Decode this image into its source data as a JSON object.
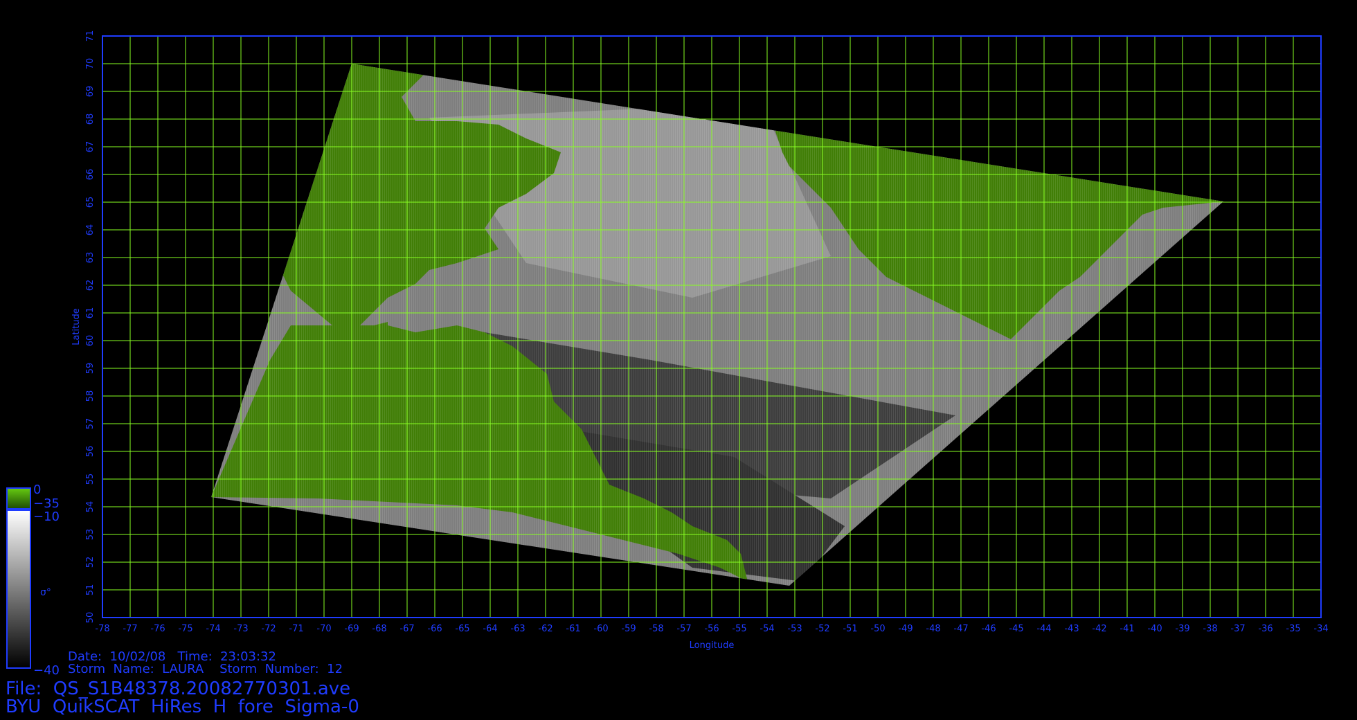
{
  "axes": {
    "lon_ticks": [
      "-78",
      "-77",
      "-76",
      "-75",
      "-74",
      "-73",
      "-72",
      "-71",
      "-70",
      "-69",
      "-68",
      "-67",
      "-66",
      "-65",
      "-64",
      "-63",
      "-62",
      "-61",
      "-60",
      "-59",
      "-58",
      "-57",
      "-56",
      "-55",
      "-54",
      "-53",
      "-52",
      "-51",
      "-50",
      "-49",
      "-48",
      "-47",
      "-46",
      "-45",
      "-44",
      "-43",
      "-42",
      "-41",
      "-40",
      "-39",
      "-38",
      "-37",
      "-36",
      "-35",
      "-34"
    ],
    "lat_ticks": [
      "50",
      "51",
      "52",
      "53",
      "54",
      "55",
      "56",
      "57",
      "58",
      "59",
      "60",
      "61",
      "62",
      "63",
      "64",
      "65",
      "66",
      "67",
      "68",
      "69",
      "70",
      "71"
    ],
    "xlabel": "Longitude",
    "ylabel": "Latitude",
    "lon_range": [
      -78,
      -34
    ],
    "lat_range": [
      50,
      71
    ],
    "grid": true
  },
  "colorbar": {
    "label": "σ°",
    "tick_top": "0",
    "tick_green_bottom": "−35",
    "tick_gray_top": "−10",
    "tick_bottom": "−40"
  },
  "info": {
    "date_line": "Date:  10/02/08   Time:  23:03:32",
    "storm_line": "Storm  Name:  LAURA    Storm  Number:  12",
    "file_line": "File:  QS_S1B48378.20082770301.ave",
    "product_line": "BYU  QuikSCAT  HiRes  H  fore  Sigma-0"
  },
  "colors": {
    "axis": "#1f3cff",
    "grid": "#88ff22",
    "land": "#4f9a08",
    "ocean_gray": "#9a9a9a",
    "background": "#000000"
  },
  "swath": {
    "corners_lonlat": [
      [
        -74,
        54.4
      ],
      [
        -69,
        70
      ],
      [
        -37.6,
        65
      ],
      [
        -53,
        51.1
      ]
    ]
  }
}
